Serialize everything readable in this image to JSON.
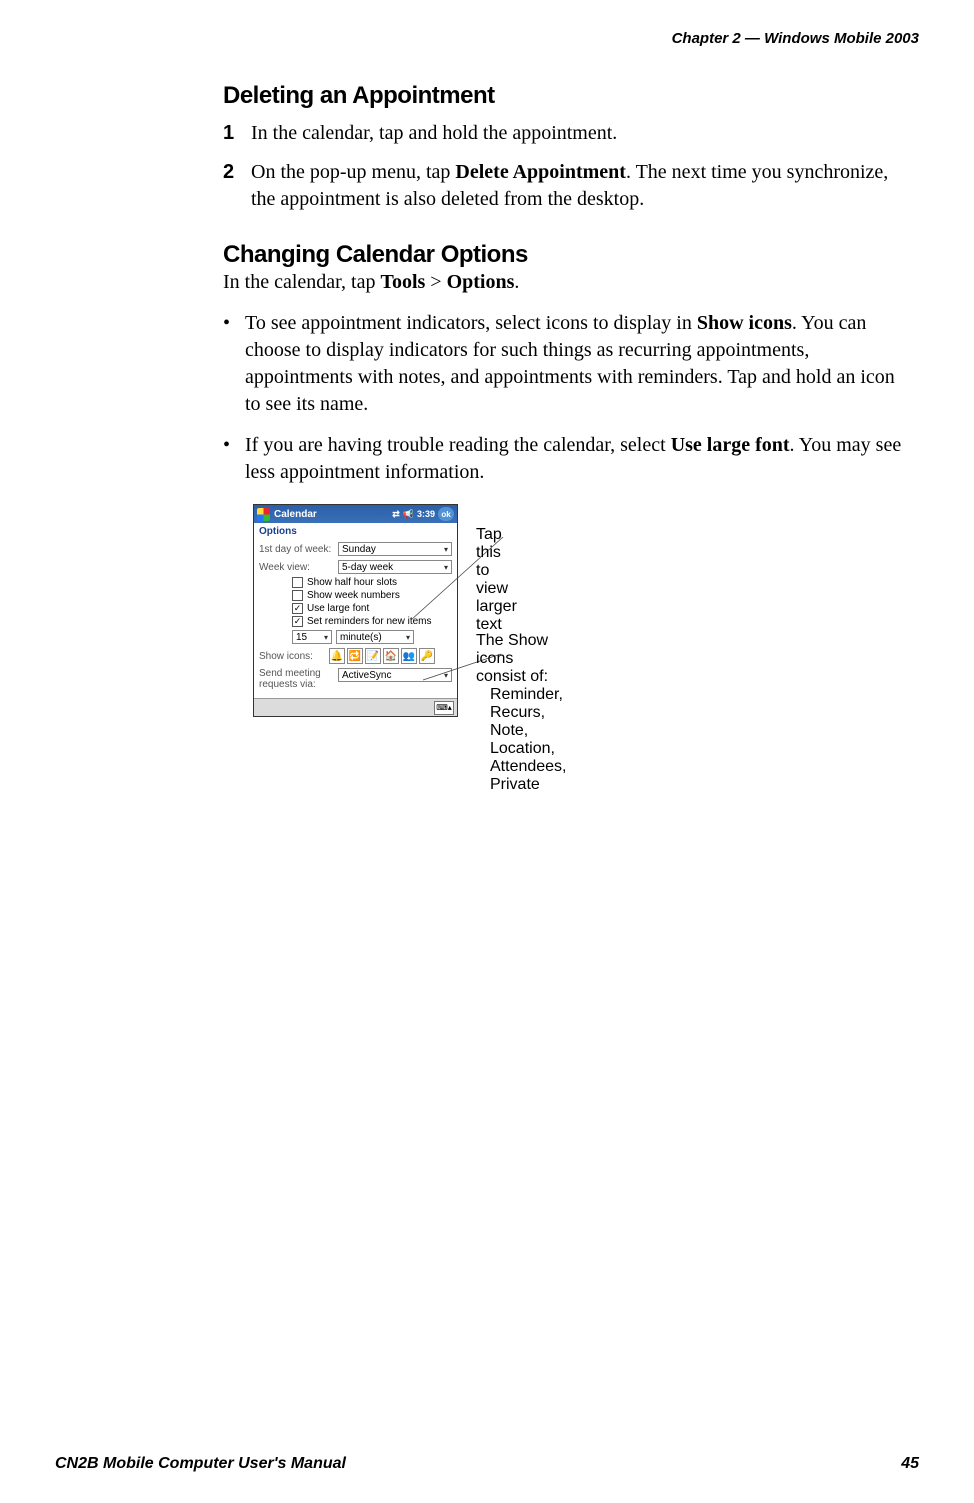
{
  "header": {
    "chapter": "Chapter 2 —  Windows Mobile 2003"
  },
  "sections": {
    "deleting": {
      "title": "Deleting an Appointment",
      "steps": [
        {
          "num": "1",
          "text": "In the calendar, tap and hold the appointment."
        },
        {
          "num": "2",
          "pre": "On the pop-up menu, tap ",
          "bold": "Delete Appointment",
          "post": ". The next time you synchronize, the appointment is also deleted from the desktop."
        }
      ]
    },
    "changing": {
      "title": "Changing Calendar Options",
      "intro_pre": "In the calendar, tap ",
      "intro_b1": "Tools",
      "intro_mid": " > ",
      "intro_b2": "Options",
      "intro_post": ".",
      "bullets": [
        {
          "pre": "To see appointment indicators, select icons to display in ",
          "bold": "Show icons",
          "post": ". You can choose to display indicators for such things as recurring appointments, appointments with notes, and appointments with reminders. Tap and hold an icon to see its name."
        },
        {
          "pre": "If you are having trouble reading the calendar, select ",
          "bold": "Use large font",
          "post": ". You may see less appointment information."
        }
      ]
    }
  },
  "screenshot": {
    "title": "Calendar",
    "time": "3:39",
    "ok": "ok",
    "subheader": "Options",
    "first_day_label": "1st day of week:",
    "first_day_value": "Sunday",
    "week_view_label": "Week view:",
    "week_view_value": "5-day week",
    "cb_half_hour": "Show half hour slots",
    "cb_week_numbers": "Show week numbers",
    "cb_large_font": "Use large font",
    "cb_reminders": "Set reminders for new items",
    "reminder_value": "15",
    "reminder_unit": "minute(s)",
    "show_icons_label": "Show icons:",
    "icons": {
      "bell": "🔔",
      "recur": "🔁",
      "note": "📝",
      "loc": "🏠",
      "att": "👥",
      "key": "🔑"
    },
    "send_label": "Send meeting requests via:",
    "send_value": "ActiveSync",
    "kbd": "⌨▴"
  },
  "callouts": {
    "c1": "Tap this to view larger text",
    "c2a": "The Show icons consist of:",
    "c2b": "Reminder, Recurs, Note, Location, Attendees, Private"
  },
  "footer": {
    "left": "CN2B Mobile Computer User's Manual",
    "right": "45"
  }
}
